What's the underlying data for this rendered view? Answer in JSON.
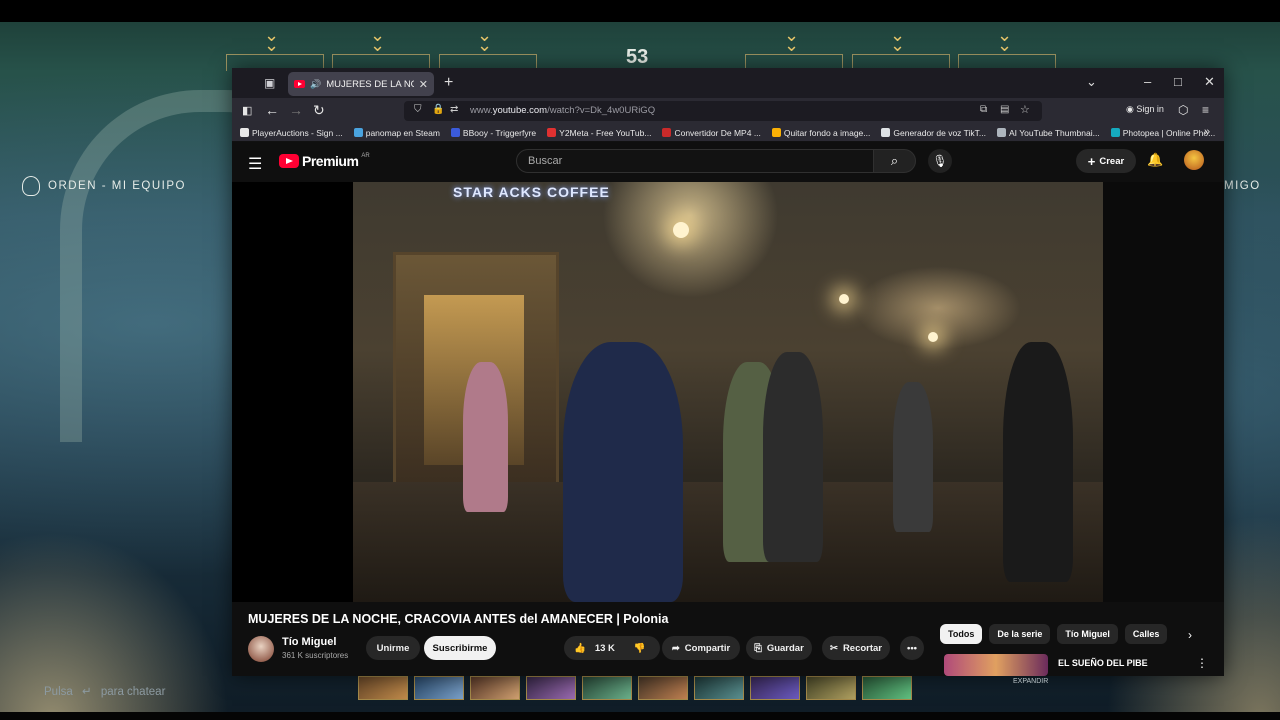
{
  "game": {
    "timer": "53",
    "team_label": "ORDEN - MI EQUIPO",
    "friend_label": "MIGO",
    "chat_hint_prefix": "Pulsa",
    "chat_hint_key": "↵",
    "chat_hint_suffix": "para chatear",
    "small_label": "EXPANDIR"
  },
  "browser": {
    "tab_title": "MUJERES DE LA NOCHE, C",
    "url_prefix": "www.",
    "url_domain": "youtube.com",
    "url_path": "/watch?v=Dk_4w0URiGQ",
    "sign_in": "Sign in",
    "bookmarks": [
      {
        "label": "PlayerAuctions - Sign ...",
        "color": "#e8e8e8"
      },
      {
        "label": "panomap en Steam",
        "color": "#4aa3df"
      },
      {
        "label": "BBooy - Triggerfyre",
        "color": "#3b5bdb"
      },
      {
        "label": "Y2Meta - Free YouTub...",
        "color": "#e03131"
      },
      {
        "label": "Convertidor De MP4 ...",
        "color": "#c92a2a"
      },
      {
        "label": "Quitar fondo a image...",
        "color": "#fab005"
      },
      {
        "label": "Generador de voz TikT...",
        "color": "#dee2e6"
      },
      {
        "label": "AI YouTube Thumbnai...",
        "color": "#adb5bd"
      },
      {
        "label": "Photopea | Online Pho...",
        "color": "#15aabf"
      }
    ]
  },
  "youtube": {
    "logo_text": "Premium",
    "logo_region": "AR",
    "search_placeholder": "Buscar",
    "create_label": "Crear",
    "video_sign": "STAR ACKS COFFEE",
    "video_title": "MUJERES DE LA NOCHE, CRACOVIA ANTES del AMANECER | Polonia",
    "channel_name": "Tío Miguel",
    "channel_subs": "361 K suscriptores",
    "join_label": "Unirme",
    "subscribe_label": "Suscribirme",
    "like_count": "13 K",
    "share_label": "Compartir",
    "save_label": "Guardar",
    "clip_label": "Recortar",
    "chips": [
      "Todos",
      "De la serie",
      "Tío Miguel",
      "Calles"
    ],
    "rec_title": "EL SUEÑO DEL PIBE"
  }
}
